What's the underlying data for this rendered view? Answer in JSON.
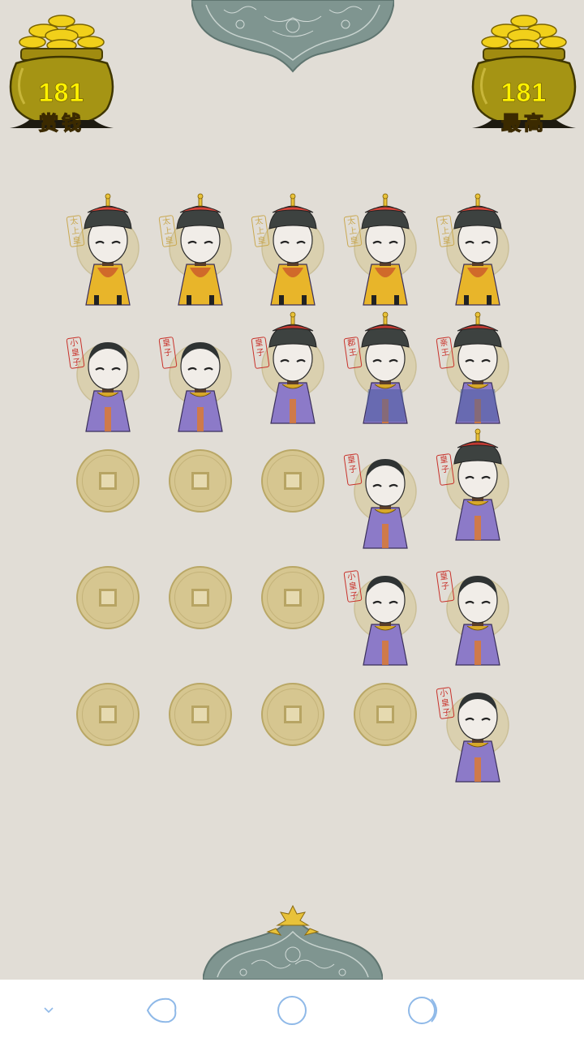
{
  "score": {
    "value": "181",
    "label": "赏钱"
  },
  "high_score": {
    "value": "181",
    "label": "最高"
  },
  "colors": {
    "background": "#e1ddd6",
    "coin": "#d6c690",
    "robe_purple": "#8c7ac8",
    "robe_yellow": "#e8b52a",
    "seal_red": "#c8312a"
  },
  "grid": {
    "rows": [
      [
        {
          "type": "emperor",
          "seal": "太上皇",
          "seal_color": "gold"
        },
        {
          "type": "emperor",
          "seal": "太上皇",
          "seal_color": "gold"
        },
        {
          "type": "emperor",
          "seal": "太上皇",
          "seal_color": "gold"
        },
        {
          "type": "emperor",
          "seal": "太上皇",
          "seal_color": "gold"
        },
        {
          "type": "emperor",
          "seal": "太上皇",
          "seal_color": "gold"
        }
      ],
      [
        {
          "type": "prince_small",
          "seal": "小皇子",
          "seal_color": "red"
        },
        {
          "type": "prince",
          "seal": "皇子",
          "seal_color": "red"
        },
        {
          "type": "prince_hat",
          "seal": "皇子",
          "seal_color": "red"
        },
        {
          "type": "junwang",
          "seal": "郡王",
          "seal_color": "red"
        },
        {
          "type": "qinwang",
          "seal": "亲王",
          "seal_color": "red"
        }
      ],
      [
        {
          "type": "empty"
        },
        {
          "type": "empty"
        },
        {
          "type": "empty"
        },
        {
          "type": "prince",
          "seal": "皇子",
          "seal_color": "red"
        },
        {
          "type": "prince_hat",
          "seal": "皇子",
          "seal_color": "red"
        }
      ],
      [
        {
          "type": "empty"
        },
        {
          "type": "empty"
        },
        {
          "type": "empty"
        },
        {
          "type": "prince_small",
          "seal": "小皇子",
          "seal_color": "red"
        },
        {
          "type": "prince",
          "seal": "皇子",
          "seal_color": "red"
        }
      ],
      [
        {
          "type": "empty"
        },
        {
          "type": "empty"
        },
        {
          "type": "empty"
        },
        {
          "type": "empty"
        },
        {
          "type": "prince_small",
          "seal": "小皇子",
          "seal_color": "red"
        }
      ]
    ]
  },
  "navbar": {
    "icons": [
      "chevron-down-icon",
      "back-icon",
      "home-icon",
      "recents-icon"
    ]
  }
}
